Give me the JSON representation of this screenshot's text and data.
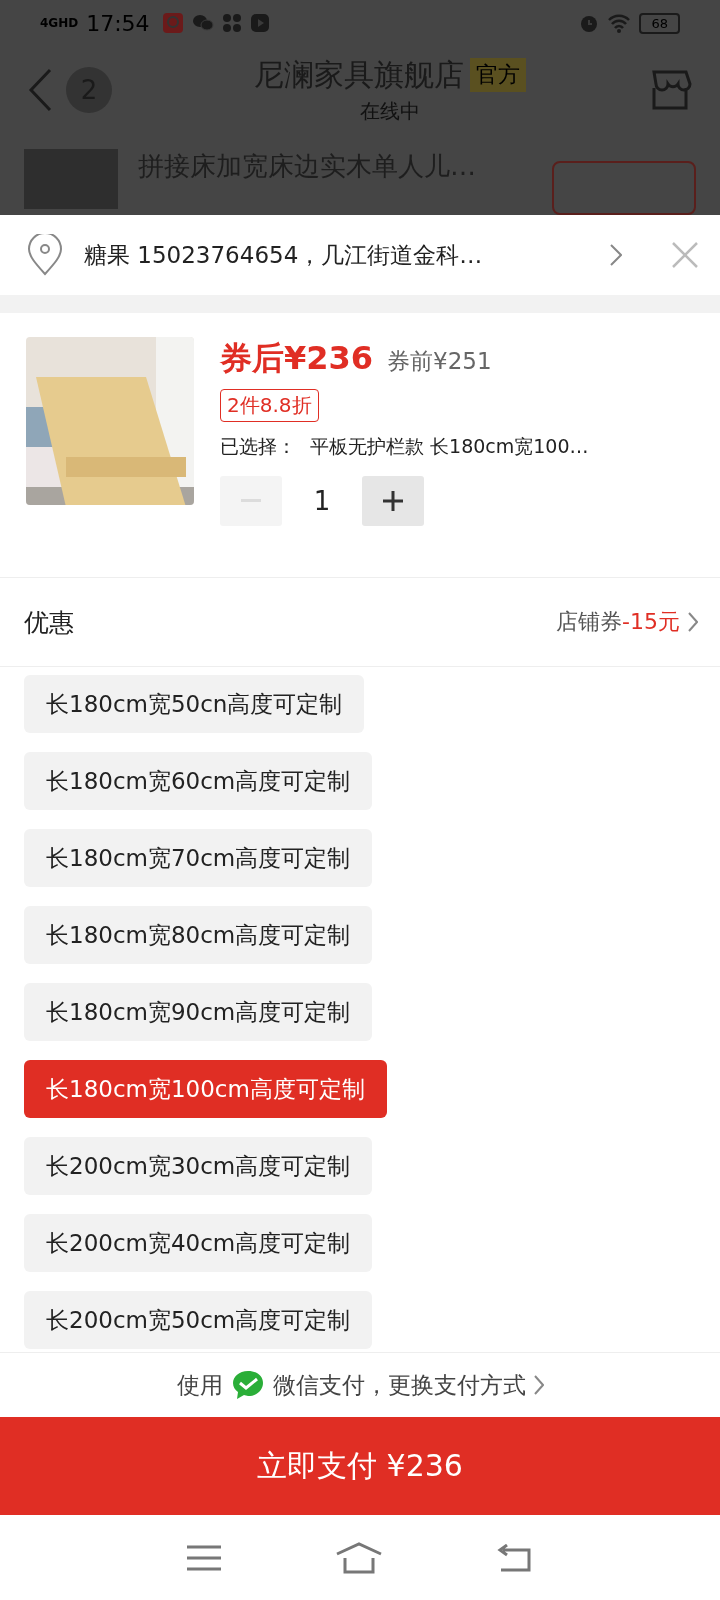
{
  "status_bar": {
    "network": "4GHD",
    "time": "17:54",
    "battery": "68"
  },
  "chat_header": {
    "unread_count": "2",
    "title": "尼澜家具旗舰店",
    "badge": "官方",
    "subtitle": "在线中"
  },
  "background_product": {
    "title": "拼接床加宽床边实木单人儿…"
  },
  "address": {
    "text": "糖果 15023764654，几江街道金科…"
  },
  "product": {
    "price": "券后¥236",
    "original_price": "券前¥251",
    "promo_tag": "2件8.8折",
    "selected_label": "已选择：",
    "selected_value": "平板无护栏款 长180cm宽100…",
    "quantity": "1",
    "decrement_disabled": true
  },
  "discount": {
    "label": "优惠",
    "coupon_label": "店铺券",
    "coupon_value": "-15元"
  },
  "options": [
    {
      "label": "长180cm宽50cn高度可定制",
      "selected": false
    },
    {
      "label": "长180cm宽60cm高度可定制",
      "selected": false
    },
    {
      "label": "长180cm宽70cm高度可定制",
      "selected": false
    },
    {
      "label": "长180cm宽80cm高度可定制",
      "selected": false
    },
    {
      "label": "长180cm宽90cm高度可定制",
      "selected": false
    },
    {
      "label": "长180cm宽100cm高度可定制",
      "selected": true
    },
    {
      "label": "长200cm宽30cm高度可定制",
      "selected": false
    },
    {
      "label": "长200cm宽40cm高度可定制",
      "selected": false
    },
    {
      "label": "长200cm宽50cm高度可定制",
      "selected": false
    }
  ],
  "payment": {
    "prefix": "使用",
    "method": "微信支付，更换支付方式"
  },
  "pay_button": {
    "label": "立即支付 ¥236"
  }
}
